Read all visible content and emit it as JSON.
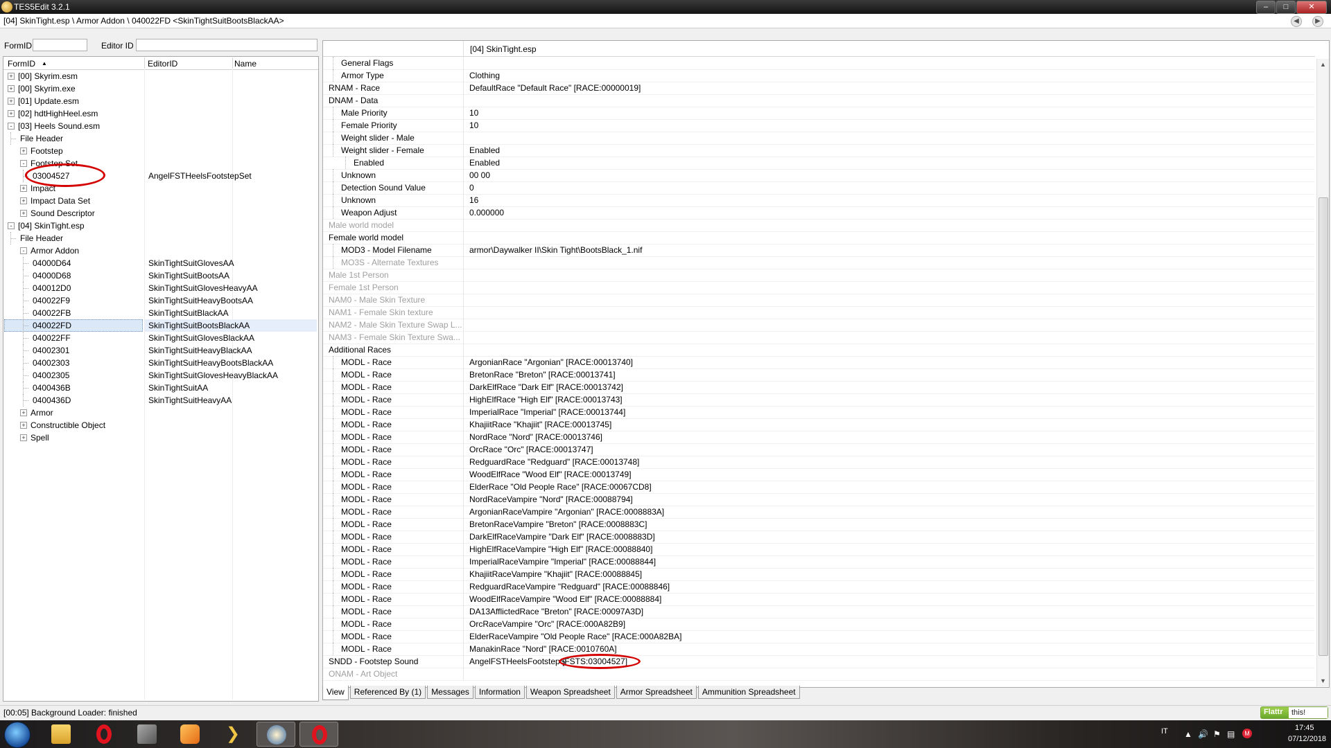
{
  "window": {
    "title": "TES5Edit 3.2.1"
  },
  "path": "[04] SkinTight.esp \\ Armor Addon \\ 040022FD <SkinTightSuitBootsBlackAA>",
  "filter": {
    "formid_label": "FormID",
    "editorid_label": "Editor ID",
    "formid_value": "",
    "editorid_value": ""
  },
  "tree": {
    "columns": {
      "formid": "FormID",
      "editorid": "EditorID",
      "name": "Name"
    },
    "rows": [
      {
        "fid": "[00] Skyrim.esm",
        "eid": ""
      },
      {
        "fid": "[00] Skyrim.exe",
        "eid": ""
      },
      {
        "fid": "[01] Update.esm",
        "eid": ""
      },
      {
        "fid": "[02] hdtHighHeel.esm",
        "eid": ""
      },
      {
        "fid": "[03] Heels Sound.esm",
        "eid": ""
      },
      {
        "fid": "File Header",
        "eid": ""
      },
      {
        "fid": "Footstep",
        "eid": ""
      },
      {
        "fid": "Footstep Set",
        "eid": ""
      },
      {
        "fid": "03004527",
        "eid": "AngelFSTHeelsFootstepSet"
      },
      {
        "fid": "Impact",
        "eid": ""
      },
      {
        "fid": "Impact Data Set",
        "eid": ""
      },
      {
        "fid": "Sound Descriptor",
        "eid": ""
      },
      {
        "fid": "[04] SkinTight.esp",
        "eid": ""
      },
      {
        "fid": "File Header",
        "eid": ""
      },
      {
        "fid": "Armor Addon",
        "eid": ""
      },
      {
        "fid": "04000D64",
        "eid": "SkinTightSuitGlovesAA"
      },
      {
        "fid": "04000D68",
        "eid": "SkinTightSuitBootsAA"
      },
      {
        "fid": "040012D0",
        "eid": "SkinTightSuitGlovesHeavyAA"
      },
      {
        "fid": "040022F9",
        "eid": "SkinTightSuitHeavyBootsAA"
      },
      {
        "fid": "040022FB",
        "eid": "SkinTightSuitBlackAA"
      },
      {
        "fid": "040022FD",
        "eid": "SkinTightSuitBootsBlackAA"
      },
      {
        "fid": "040022FF",
        "eid": "SkinTightSuitGlovesBlackAA"
      },
      {
        "fid": "04002301",
        "eid": "SkinTightSuitHeavyBlackAA"
      },
      {
        "fid": "04002303",
        "eid": "SkinTightSuitHeavyBootsBlackAA"
      },
      {
        "fid": "04002305",
        "eid": "SkinTightSuitGlovesHeavyBlackAA"
      },
      {
        "fid": "0400436B",
        "eid": "SkinTightSuitAA"
      },
      {
        "fid": "0400436D",
        "eid": "SkinTightSuitHeavyAA"
      },
      {
        "fid": "Armor",
        "eid": ""
      },
      {
        "fid": "Constructible Object",
        "eid": ""
      },
      {
        "fid": "Spell",
        "eid": ""
      }
    ]
  },
  "view": {
    "header": "[04] SkinTight.esp",
    "rows": [
      {
        "label": "General Flags",
        "value": ""
      },
      {
        "label": "Armor Type",
        "value": "Clothing"
      },
      {
        "label": "RNAM - Race",
        "value": "DefaultRace \"Default Race\" [RACE:00000019]"
      },
      {
        "label": "DNAM - Data",
        "value": ""
      },
      {
        "label": "Male Priority",
        "value": "10"
      },
      {
        "label": "Female Priority",
        "value": "10"
      },
      {
        "label": "Weight slider - Male",
        "value": ""
      },
      {
        "label": "Weight slider - Female",
        "value": "Enabled"
      },
      {
        "label": "Enabled",
        "value": "Enabled"
      },
      {
        "label": "Unknown",
        "value": "00 00"
      },
      {
        "label": "Detection Sound Value",
        "value": "0"
      },
      {
        "label": "Unknown",
        "value": "16"
      },
      {
        "label": "Weapon Adjust",
        "value": "0.000000"
      },
      {
        "label": "Male world model",
        "value": ""
      },
      {
        "label": "Female world model",
        "value": ""
      },
      {
        "label": "MOD3 - Model Filename",
        "value": "armor\\Daywalker II\\Skin Tight\\BootsBlack_1.nif"
      },
      {
        "label": "MO3S - Alternate Textures",
        "value": ""
      },
      {
        "label": "Male 1st Person",
        "value": ""
      },
      {
        "label": "Female 1st Person",
        "value": ""
      },
      {
        "label": "NAM0 - Male Skin Texture",
        "value": ""
      },
      {
        "label": "NAM1 - Female Skin texture",
        "value": ""
      },
      {
        "label": "NAM2 - Male Skin Texture Swap L...",
        "value": ""
      },
      {
        "label": "NAM3 - Female Skin Texture Swa...",
        "value": ""
      },
      {
        "label": "Additional Races",
        "value": ""
      },
      {
        "label": "MODL - Race",
        "value": "ArgonianRace \"Argonian\" [RACE:00013740]"
      },
      {
        "label": "MODL - Race",
        "value": "BretonRace \"Breton\" [RACE:00013741]"
      },
      {
        "label": "MODL - Race",
        "value": "DarkElfRace \"Dark Elf\" [RACE:00013742]"
      },
      {
        "label": "MODL - Race",
        "value": "HighElfRace \"High Elf\" [RACE:00013743]"
      },
      {
        "label": "MODL - Race",
        "value": "ImperialRace \"Imperial\" [RACE:00013744]"
      },
      {
        "label": "MODL - Race",
        "value": "KhajiitRace \"Khajiit\" [RACE:00013745]"
      },
      {
        "label": "MODL - Race",
        "value": "NordRace \"Nord\" [RACE:00013746]"
      },
      {
        "label": "MODL - Race",
        "value": "OrcRace \"Orc\" [RACE:00013747]"
      },
      {
        "label": "MODL - Race",
        "value": "RedguardRace \"Redguard\" [RACE:00013748]"
      },
      {
        "label": "MODL - Race",
        "value": "WoodElfRace \"Wood Elf\" [RACE:00013749]"
      },
      {
        "label": "MODL - Race",
        "value": "ElderRace \"Old People Race\" [RACE:00067CD8]"
      },
      {
        "label": "MODL - Race",
        "value": "NordRaceVampire \"Nord\" [RACE:00088794]"
      },
      {
        "label": "MODL - Race",
        "value": "ArgonianRaceVampire \"Argonian\" [RACE:0008883A]"
      },
      {
        "label": "MODL - Race",
        "value": "BretonRaceVampire \"Breton\" [RACE:0008883C]"
      },
      {
        "label": "MODL - Race",
        "value": "DarkElfRaceVampire \"Dark Elf\" [RACE:0008883D]"
      },
      {
        "label": "MODL - Race",
        "value": "HighElfRaceVampire \"High Elf\" [RACE:00088840]"
      },
      {
        "label": "MODL - Race",
        "value": "ImperialRaceVampire \"Imperial\" [RACE:00088844]"
      },
      {
        "label": "MODL - Race",
        "value": "KhajiitRaceVampire \"Khajiit\" [RACE:00088845]"
      },
      {
        "label": "MODL - Race",
        "value": "RedguardRaceVampire \"Redguard\" [RACE:00088846]"
      },
      {
        "label": "MODL - Race",
        "value": "WoodElfRaceVampire \"Wood Elf\" [RACE:00088884]"
      },
      {
        "label": "MODL - Race",
        "value": "DA13AfflictedRace \"Breton\" [RACE:00097A3D]"
      },
      {
        "label": "MODL - Race",
        "value": "OrcRaceVampire \"Orc\" [RACE:000A82B9]"
      },
      {
        "label": "MODL - Race",
        "value": "ElderRaceVampire \"Old People Race\" [RACE:000A82BA]"
      },
      {
        "label": "MODL - Race",
        "value": "ManakinRace \"Nord\" [RACE:0010760A]"
      },
      {
        "label": "SNDD - Footstep Sound",
        "value": "AngelFSTHeelsFootstepS"
      },
      {
        "label": "ONAM - Art Object",
        "value": ""
      }
    ],
    "sndd_ref": "[FSTS:03004527]"
  },
  "tabs": [
    "View",
    "Referenced By (1)",
    "Messages",
    "Information",
    "Weapon Spreadsheet",
    "Armor Spreadsheet",
    "Ammunition Spreadsheet"
  ],
  "status": {
    "message": "[00:05] Background Loader: finished"
  },
  "flattr": {
    "label": "Flattr",
    "sub": "this!"
  },
  "tray": {
    "lang": "IT",
    "time": "17:45",
    "date": "07/12/2018"
  },
  "colors": {
    "highlight": "#d40000",
    "selection": "#dbe8f8"
  }
}
